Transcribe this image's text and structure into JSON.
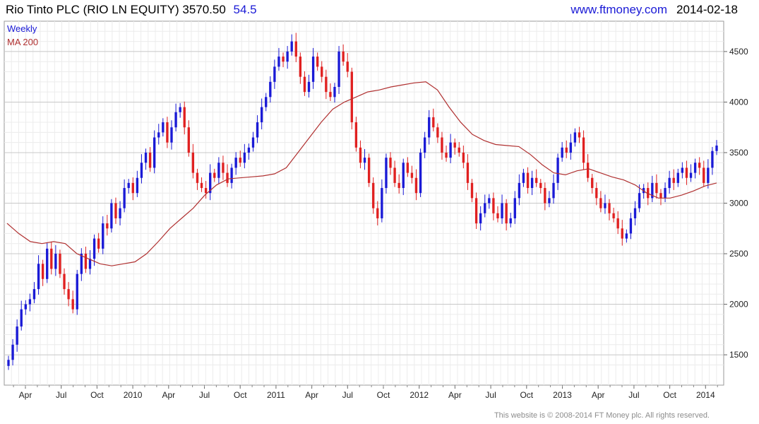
{
  "header": {
    "title": "Rio Tinto PLC (RIO LN EQUITY)",
    "price": "3570.50",
    "change": "54.5",
    "site": "www.ftmoney.com",
    "date": "2014-02-18"
  },
  "footer": "This website is © 2008-2014 FT Money plc. All rights reserved.",
  "colors": {
    "up": "#1a1ad6",
    "down": "#e02020",
    "ma": "#b03030",
    "grid": "#dcdcdc",
    "legend_weekly": "#1a1ad6",
    "legend_ma": "#b03030"
  },
  "chart_data": {
    "type": "candlestick",
    "legend": [
      "Weekly",
      "MA 200"
    ],
    "ylim": [
      1200,
      4800
    ],
    "y_ticks": [
      1500,
      2000,
      2500,
      3000,
      3500,
      4000,
      4500
    ],
    "x_ticks": [
      "Apr",
      "Jul",
      "Oct",
      "2010",
      "Apr",
      "Jul",
      "Oct",
      "2011",
      "Apr",
      "Jul",
      "Oct",
      "2012",
      "Apr",
      "Jul",
      "Oct",
      "2013",
      "Apr",
      "Jul",
      "Oct",
      "2014"
    ],
    "series": [
      {
        "name": "Weekly",
        "close": [
          1450,
          1600,
          1780,
          1950,
          2000,
          2050,
          2150,
          2400,
          2250,
          2550,
          2350,
          2500,
          2300,
          2150,
          2050,
          1950,
          2300,
          2500,
          2350,
          2450,
          2650,
          2550,
          2800,
          2750,
          3000,
          2850,
          2950,
          3150,
          3200,
          3100,
          3250,
          3400,
          3500,
          3350,
          3650,
          3700,
          3800,
          3600,
          3750,
          3900,
          3950,
          3750,
          3500,
          3300,
          3200,
          3150,
          3100,
          3300,
          3250,
          3400,
          3300,
          3200,
          3350,
          3450,
          3400,
          3500,
          3550,
          3650,
          3800,
          3950,
          4050,
          4200,
          4350,
          4450,
          4400,
          4500,
          4600,
          4450,
          4250,
          4100,
          4200,
          4450,
          4350,
          4250,
          4100,
          4050,
          4150,
          4500,
          4400,
          4300,
          3800,
          3550,
          3400,
          3450,
          3200,
          2950,
          2850,
          3150,
          3450,
          3350,
          3200,
          3150,
          3400,
          3300,
          3250,
          3100,
          3500,
          3650,
          3850,
          3750,
          3650,
          3500,
          3450,
          3600,
          3550,
          3500,
          3400,
          3200,
          3050,
          2800,
          2900,
          3000,
          3050,
          2900,
          2850,
          3000,
          2800,
          2850,
          3050,
          3200,
          3300,
          3150,
          3250,
          3200,
          3150,
          3000,
          3050,
          3200,
          3450,
          3550,
          3500,
          3600,
          3700,
          3650,
          3400,
          3250,
          3150,
          3050,
          2950,
          3000,
          2900,
          2850,
          2750,
          2650,
          2700,
          2850,
          2950,
          3100,
          3150,
          3050,
          3200,
          3100,
          3050,
          3150,
          3250,
          3200,
          3300,
          3350,
          3250,
          3300,
          3400,
          3350,
          3200,
          3350,
          3516,
          3570
        ]
      },
      {
        "name": "MA 200",
        "values": [
          2800,
          2700,
          2620,
          2600,
          2620,
          2600,
          2500,
          2450,
          2400,
          2380,
          2400,
          2420,
          2500,
          2620,
          2750,
          2850,
          2950,
          3080,
          3180,
          3240,
          3250,
          3260,
          3270,
          3290,
          3350,
          3500,
          3650,
          3800,
          3930,
          4000,
          4050,
          4100,
          4120,
          4150,
          4170,
          4190,
          4200,
          4120,
          3950,
          3800,
          3680,
          3620,
          3580,
          3570,
          3560,
          3480,
          3380,
          3300,
          3280,
          3320,
          3340,
          3300,
          3260,
          3230,
          3180,
          3100,
          3050,
          3050,
          3080,
          3120,
          3170,
          3200
        ]
      }
    ]
  }
}
